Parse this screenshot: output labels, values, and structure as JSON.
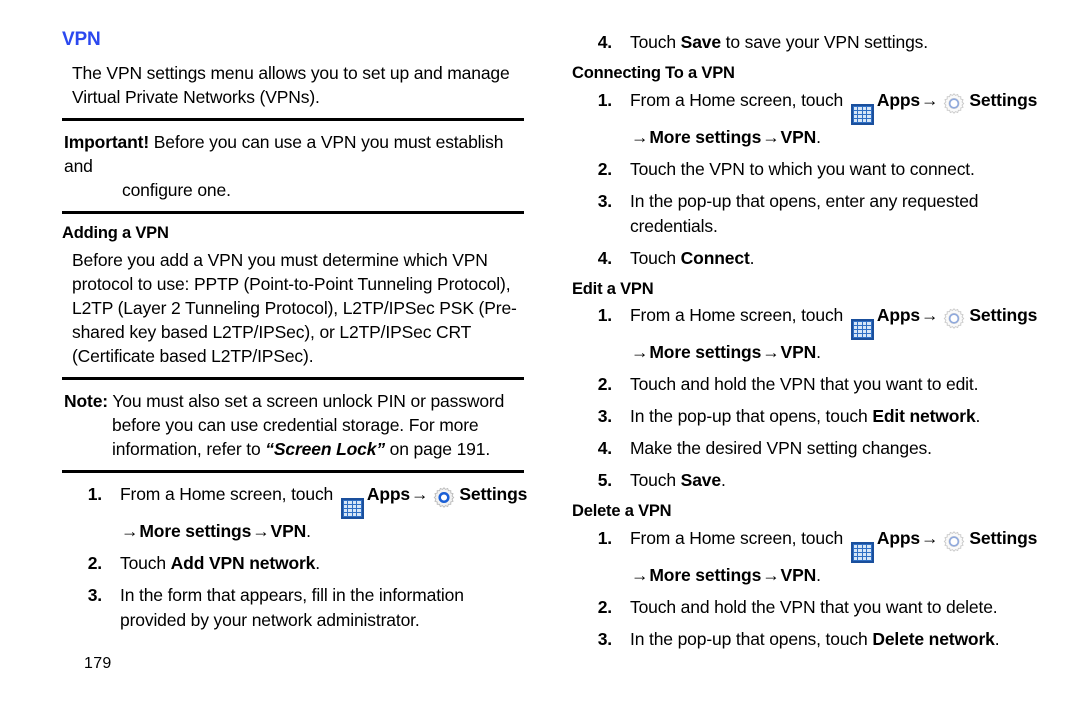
{
  "document": {
    "page_number": "179",
    "accent_color": "#2b48ef"
  },
  "left_column": {
    "section_heading": "VPN",
    "intro_paragraph": "The VPN settings menu allows you to set up and manage Virtual Private Networks (VPNs).",
    "important_callout": {
      "lead": "Important!",
      "body": "Before you can use a VPN you must establish and",
      "hanging": "configure one."
    },
    "adding_heading": "Adding a VPN",
    "adding_paragraph": "Before you add a VPN you must determine which VPN protocol to use: PPTP (Point-to-Point Tunneling Protocol), L2TP (Layer 2 Tunneling Protocol), L2TP/IPSec PSK (Pre-shared key based L2TP/IPSec), or L2TP/IPSec CRT (Certificate based L2TP/IPSec).",
    "note_callout": {
      "lead": "Note:",
      "body": "You must also set a screen unlock PIN or password",
      "hanging_line_1": "before you can use credential storage. For more",
      "hanging_line_2_pre": "information, refer to ",
      "hanging_line_2_italic": "“Screen Lock”",
      "hanging_line_2_post": " on page 191."
    },
    "steps": [
      {
        "num": "1.",
        "pre_apps": "From a Home screen, touch ",
        "apps_label": "Apps",
        "arrow": "→",
        "settings_label": "Settings",
        "continuation_arrow": "→",
        "continuation_more": "More settings",
        "continuation_arrow_2": "→",
        "continuation_vpn": "VPN",
        "continuation_period": "."
      },
      {
        "num": "2.",
        "pre": "Touch ",
        "bold": "Add VPN network",
        "post": "."
      },
      {
        "num": "3.",
        "text": "In the form that appears, fill in the information provided by your network administrator."
      }
    ]
  },
  "right_column": {
    "step4_save": {
      "num": "4.",
      "pre": "Touch ",
      "bold": "Save",
      "post": " to save your VPN settings."
    },
    "connecting_heading": "Connecting To a VPN",
    "connecting_steps": [
      {
        "num": "1.",
        "pre_apps": "From a Home screen, touch ",
        "apps_label": "Apps",
        "arrow": "→",
        "settings_label": "Settings",
        "continuation_arrow": "→",
        "continuation_more": "More settings",
        "continuation_arrow_2": "→",
        "continuation_vpn": "VPN",
        "continuation_period": "."
      },
      {
        "num": "2.",
        "text": "Touch the VPN to which you want to connect."
      },
      {
        "num": "3.",
        "text": "In the pop-up that opens, enter any requested credentials."
      },
      {
        "num": "4.",
        "pre": "Touch ",
        "bold": "Connect",
        "post": "."
      }
    ],
    "edit_heading": "Edit a VPN",
    "edit_steps": [
      {
        "num": "1.",
        "pre_apps": "From a Home screen, touch ",
        "apps_label": "Apps",
        "arrow": "→",
        "settings_label": "Settings",
        "continuation_arrow": "→",
        "continuation_more": "More settings",
        "continuation_arrow_2": "→",
        "continuation_vpn": "VPN",
        "continuation_period": "."
      },
      {
        "num": "2.",
        "text": "Touch and hold the VPN that you want to edit."
      },
      {
        "num": "3.",
        "pre": "In the pop-up that opens, touch ",
        "bold": "Edit network",
        "post": "."
      },
      {
        "num": "4.",
        "text": "Make the desired VPN setting changes."
      },
      {
        "num": "5.",
        "pre": "Touch ",
        "bold": "Save",
        "post": "."
      }
    ],
    "delete_heading": "Delete a VPN",
    "delete_steps": [
      {
        "num": "1.",
        "pre_apps": "From a Home screen, touch ",
        "apps_label": "Apps",
        "arrow": "→",
        "settings_label": "Settings",
        "continuation_arrow": "→",
        "continuation_more": "More settings",
        "continuation_arrow_2": "→",
        "continuation_vpn": "VPN",
        "continuation_period": "."
      },
      {
        "num": "2.",
        "text": "Touch and hold the VPN that you want to delete."
      },
      {
        "num": "3.",
        "pre": "In the pop-up that opens, touch ",
        "bold": "Delete network",
        "post": "."
      }
    ]
  },
  "icons": {
    "apps": "apps-grid-icon",
    "settings": "gear-icon"
  }
}
